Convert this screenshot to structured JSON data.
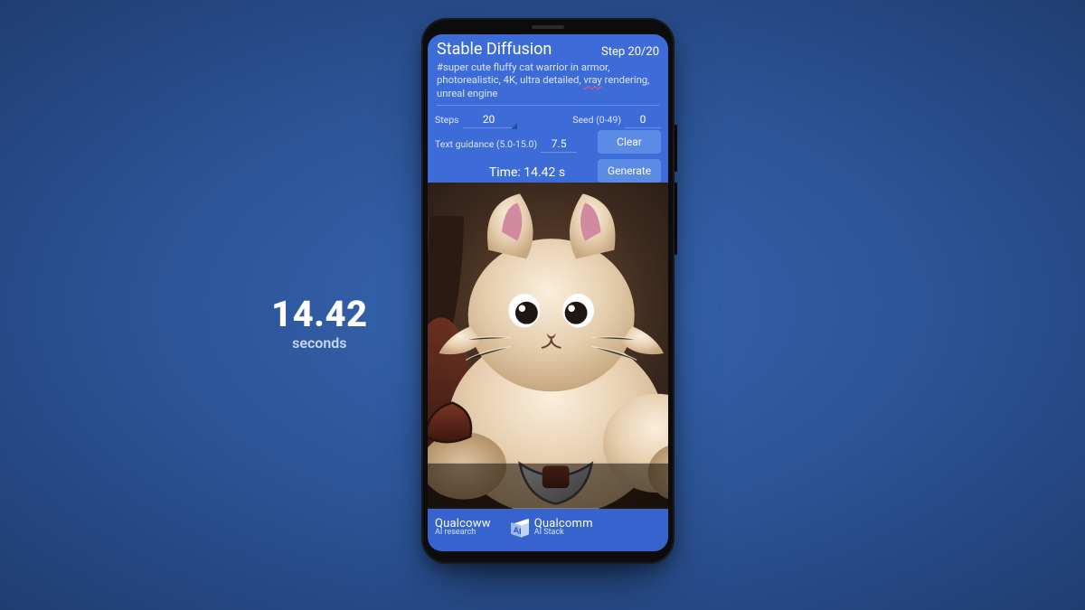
{
  "side_label": {
    "value": "14.42",
    "unit": "seconds"
  },
  "app": {
    "title": "Stable Diffusion",
    "step_label": "Step 20/20",
    "prompt_prefix": "#super cute fluffy cat warrior in armor, photorealistic, 4K, ultra detailed, ",
    "prompt_squiggle": "vray",
    "prompt_suffix": " rendering, unreal engine"
  },
  "params": {
    "steps_label": "Steps",
    "steps_value": "20",
    "seed_label": "Seed (0-49)",
    "seed_value": "0",
    "guidance_label": "Text guidance (5.0-15.0)",
    "guidance_value": "7.5",
    "clear_label": "Clear",
    "generate_label": "Generate",
    "time_line": "Time: 14.42 s"
  },
  "brand": {
    "q1_top": "Qualcoww",
    "q1_sub": "AI research",
    "q2_top": "Qualcomm",
    "q2_sub": "AI Stack"
  }
}
